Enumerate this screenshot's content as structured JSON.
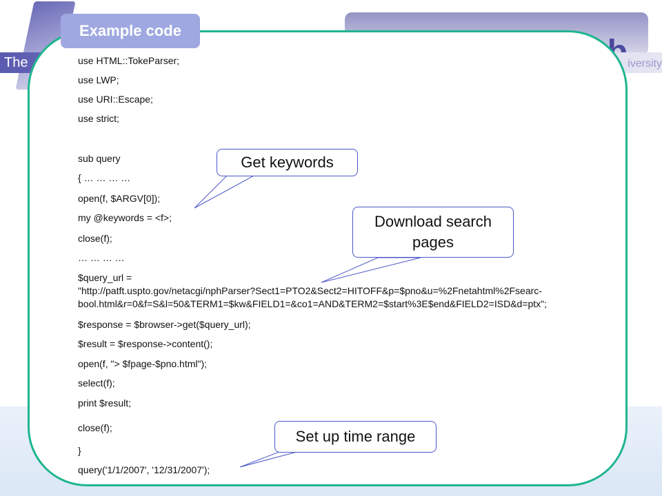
{
  "background": {
    "banner_left": "The",
    "banner_right": "iversity",
    "title_fragment": "b"
  },
  "tab": {
    "label": "Example code"
  },
  "code": [
    "use HTML::TokeParser;",
    "use LWP;",
    "use URI::Escape;",
    "use strict;",
    "sub query",
    "{ … … … …",
    "open(f, $ARGV[0]);",
    "my @keywords = <f>;",
    "close(f);",
    "… … … …",
    "$query_url =",
    "\"http://patft.uspto.gov/netacgi/nphParser?Sect1=PTO2&Sect2=HITOFF&p=$pno&u=%2Fnetahtml%2Fsearc-",
    "bool.html&r=0&f=S&l=50&TERM1=$kw&FIELD1=&co1=AND&TERM2=$start%3E$end&FIELD2=ISD&d=ptx\";",
    "$response = $browser->get($query_url);",
    "$result = $response->content();",
    "open(f, \"> $fpage-$pno.html\");",
    "select(f);",
    "print $result;",
    "close(f);",
    "}",
    "query('1/1/2007', '12/31/2007');"
  ],
  "callouts": {
    "keywords": "Get keywords",
    "download": "Download search pages",
    "timerange": "Set up time range"
  },
  "colors": {
    "panel_border": "#1fb58f",
    "tab_bg": "#9fa8e0",
    "callout_border": "#4b57c7"
  }
}
